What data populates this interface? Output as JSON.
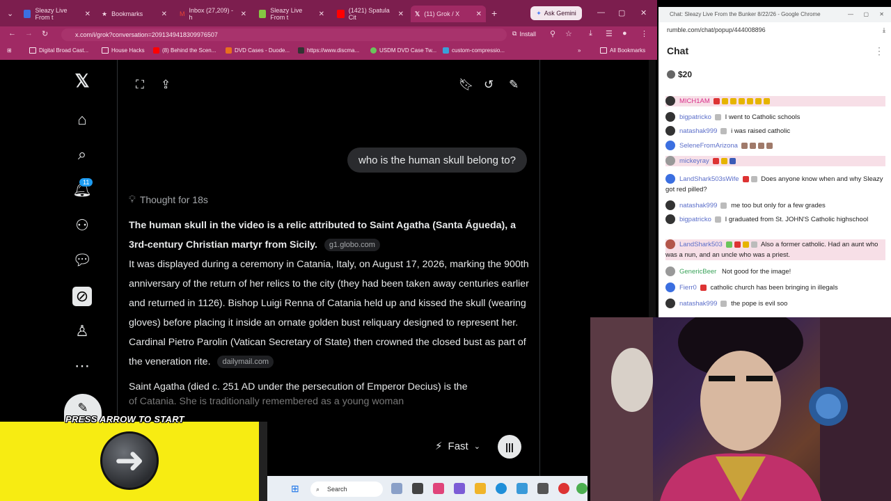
{
  "browser": {
    "tabs": [
      {
        "label": "Sleazy Live From t",
        "color": "#3b6fe0"
      },
      {
        "label": "Bookmarks",
        "color": "#f4d9e6"
      },
      {
        "label": "Inbox (27,209) - h",
        "color": "#ea4335"
      },
      {
        "label": "Sleazy Live From t",
        "color": "#85c742"
      },
      {
        "label": "(1421) Spatula Cit",
        "color": "#ff0000"
      },
      {
        "label": "(11) Grok / X",
        "color": "#000000"
      }
    ],
    "gemini_label": "Ask Gemini",
    "url": "x.com/i/grok?conversation=2091349418309976507",
    "install_label": "Install",
    "bookmarks": [
      "Digital Broad Cast...",
      "House Hacks",
      "(8) Behind the Scen...",
      "DVD Cases - Duode...",
      "https://www.discma...",
      "USDM DVD Case Tw...",
      "custom-compressio..."
    ],
    "all_bookmarks": "All Bookmarks"
  },
  "x": {
    "notification_count": "11",
    "user_message": "who is the human skull belong to?",
    "thought_label": "Thought for 18s",
    "answer_bold": "The human skull in the video is a relic attributed to Saint Agatha (Santa Águeda), a 3rd-century Christian martyr from Sicily.",
    "source_1": "g1.globo.com",
    "answer_p1": "It was displayed during a ceremony in Catania, Italy, on August 17, 2026, marking the 900th anniversary of the return of her relics to the city (they had been taken away centuries earlier and returned in 1126). Bishop Luigi Renna of Catania held up and kissed the skull (wearing gloves) before placing it inside an ornate golden bust reliquary designed to represent her. Cardinal Pietro Parolin (Vatican Secretary of State) then crowned the closed bust as part of the veneration rite.",
    "source_2": "dailymail.com",
    "answer_p2": "Saint Agatha (died c. 251 AD under the persecution of Emperor Decius) is the",
    "answer_p2_cut": "of Catania. She is traditionally remembered as a young woman",
    "fast_label": "Fast"
  },
  "overlay": {
    "press_label": "PRESS ARROW TO START"
  },
  "taskbar": {
    "search_placeholder": "Search"
  },
  "chat_window": {
    "title": "Chat: Sleazy Live From the Bunker 8/22/26 - Google Chrome",
    "url": "rumble.com/chat/popup/444008896",
    "header": "Chat",
    "price": "$20",
    "messages": [
      {
        "user": "MICH1AM",
        "text": "",
        "style": "pink"
      },
      {
        "user": "bigpatricko",
        "text": "I went to Catholic schools",
        "style": "blue"
      },
      {
        "user": "natashak999",
        "text": "i was raised catholic",
        "style": "blue"
      },
      {
        "user": "SeleneFromArizona",
        "text": "",
        "style": "blue"
      },
      {
        "user": "mickeyray",
        "text": "",
        "style": "blue"
      },
      {
        "user": "LandShark503sWife",
        "text": "Does anyone know when and why Sleazy got red pilled?",
        "style": "blue"
      },
      {
        "user": "natashak999",
        "text": "me too but only for a few grades",
        "style": "blue"
      },
      {
        "user": "bigpatricko",
        "text": "I graduated from St. JOHN'S Catholic highschool",
        "style": "blue"
      },
      {
        "user": "LandShark503",
        "text": "Also a former catholic. Had an aunt who was a nun, and an uncle who was a priest.",
        "style": "blue"
      },
      {
        "user": "GenericBeer",
        "text": "Not good for the image!",
        "style": "green"
      },
      {
        "user": "Fierr0",
        "text": "catholic church has been bringing in illegals",
        "style": "blue"
      },
      {
        "user": "natashak999",
        "text": "the pope is evil soo",
        "style": "blue"
      }
    ]
  }
}
